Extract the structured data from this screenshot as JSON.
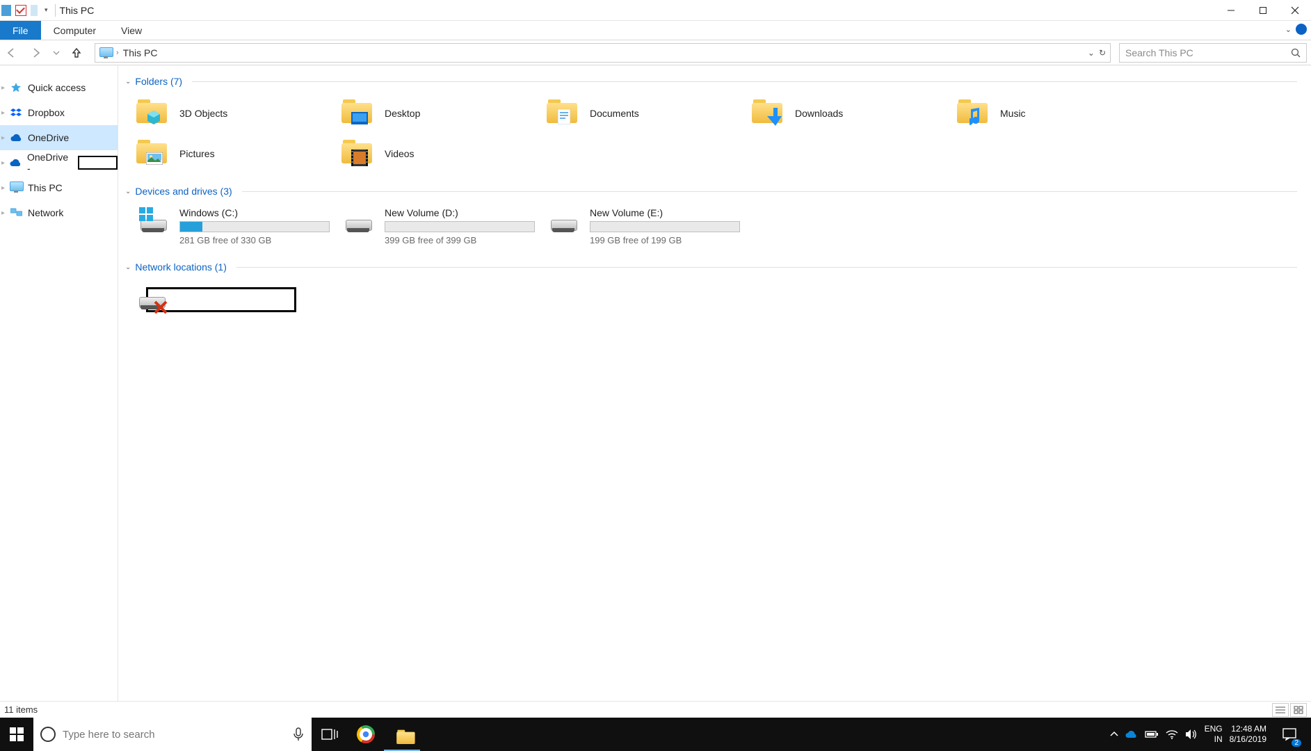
{
  "window": {
    "title": "This PC"
  },
  "ribbon": {
    "tabs": {
      "file": "File",
      "computer": "Computer",
      "view": "View"
    }
  },
  "address": {
    "location": "This PC",
    "search_placeholder": "Search This PC"
  },
  "nav": {
    "quick_access": "Quick access",
    "dropbox": "Dropbox",
    "onedrive": "OneDrive",
    "onedrive2_prefix": "OneDrive -",
    "this_pc": "This PC",
    "network": "Network"
  },
  "groups": {
    "folders_label": "Folders (7)",
    "drives_label": "Devices and drives (3)",
    "netloc_label": "Network locations (1)"
  },
  "folders": [
    {
      "name": "3D Objects"
    },
    {
      "name": "Desktop"
    },
    {
      "name": "Documents"
    },
    {
      "name": "Downloads"
    },
    {
      "name": "Music"
    },
    {
      "name": "Pictures"
    },
    {
      "name": "Videos"
    }
  ],
  "drives": [
    {
      "name": "Windows (C:)",
      "free": "281 GB free of 330 GB",
      "fill_pct": 15
    },
    {
      "name": "New Volume (D:)",
      "free": "399 GB free of 399 GB",
      "fill_pct": 0
    },
    {
      "name": "New Volume (E:)",
      "free": "199 GB free of 199 GB",
      "fill_pct": 0
    }
  ],
  "statusbar": {
    "count": "11 items"
  },
  "taskbar": {
    "search_placeholder": "Type here to search",
    "lang1": "ENG",
    "lang2": "IN",
    "time": "12:48 AM",
    "date": "8/16/2019",
    "notif_count": "2"
  }
}
